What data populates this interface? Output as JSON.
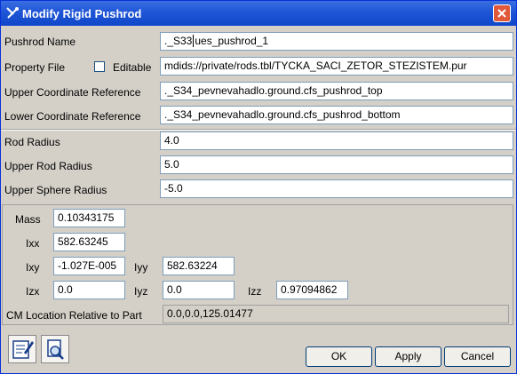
{
  "window": {
    "title": "Modify Rigid Pushrod",
    "title_icon": "pushrod-icon",
    "close_icon": "close-icon"
  },
  "form": {
    "pushrod_name": {
      "label": "Pushrod Name",
      "value_prefix": "._S33",
      "value_suffix": "ues_pushrod_1"
    },
    "property_file": {
      "label": "Property File",
      "editable_label": "Editable",
      "editable_checked": false,
      "value": "mdids://private/rods.tbl/TYCKA_SACI_ZETOR_STEZISTEM.pur"
    },
    "upper_coord_ref": {
      "label": "Upper Coordinate Reference",
      "value": "._S34_pevnevahadlo.ground.cfs_pushrod_top"
    },
    "lower_coord_ref": {
      "label": "Lower Coordinate Reference",
      "value": "._S34_pevnevahadlo.ground.cfs_pushrod_bottom"
    },
    "rod_radius": {
      "label": "Rod Radius",
      "value": "4.0"
    },
    "upper_rod_radius": {
      "label": "Upper Rod Radius",
      "value": "5.0"
    },
    "upper_sphere_radius": {
      "label": "Upper Sphere Radius",
      "value": "-5.0"
    }
  },
  "mass_props": {
    "mass": {
      "label": "Mass",
      "value": "0.10343175"
    },
    "ixx": {
      "label": "Ixx",
      "value": "582.63245"
    },
    "ixy": {
      "label": "Ixy",
      "value": "-1.027E-005"
    },
    "iyy": {
      "label": "Iyy",
      "value": "582.63224"
    },
    "izx": {
      "label": "Izx",
      "value": "0.0"
    },
    "iyz": {
      "label": "Iyz",
      "value": "0.0"
    },
    "izz": {
      "label": "Izz",
      "value": "0.97094862"
    },
    "cm_location": {
      "label": "CM Location Relative to Part",
      "value": "0.0,0.0,125.01477"
    }
  },
  "toolbar": {
    "edit_icon": "edit-notes-icon",
    "info_icon": "document-magnify-icon"
  },
  "buttons": {
    "ok": "OK",
    "apply": "Apply",
    "cancel": "Cancel"
  },
  "colors": {
    "titlebar": "#1f56d8",
    "dialog_bg": "#d4d0c8",
    "close_button": "#e0593a"
  }
}
